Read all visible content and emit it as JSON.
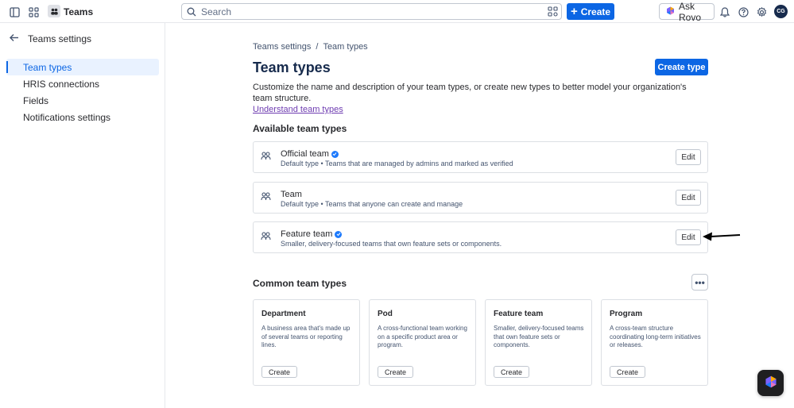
{
  "topbar": {
    "app_name": "Teams",
    "search_placeholder": "Search",
    "create_label": "Create",
    "ask_rovo_label": "Ask Rovo",
    "avatar_initials": "CG",
    "accent": "#0c66e4"
  },
  "sidebar": {
    "title": "Teams settings",
    "items": [
      {
        "label": "Team types",
        "active": true
      },
      {
        "label": "HRIS connections",
        "active": false
      },
      {
        "label": "Fields",
        "active": false
      },
      {
        "label": "Notifications settings",
        "active": false
      }
    ]
  },
  "main": {
    "breadcrumb": [
      "Teams settings",
      "/",
      "Team types"
    ],
    "title": "Team types",
    "create_type_label": "Create type",
    "description": "Customize the name and description of your team types, or create new types to better model your organization's team structure.",
    "description_link": "Understand team types",
    "available_title": "Available team types",
    "available_types": [
      {
        "name": "Official team",
        "verified": true,
        "subtitle": "Default type • Teams that are managed by admins and marked as verified",
        "edit_label": "Edit"
      },
      {
        "name": "Team",
        "verified": false,
        "subtitle": "Default type • Teams that anyone can create and manage",
        "edit_label": "Edit"
      },
      {
        "name": "Feature team",
        "verified": true,
        "subtitle": "Smaller, delivery-focused teams that own feature sets or components.",
        "edit_label": "Edit"
      }
    ],
    "common_title": "Common team types",
    "more_label": "•••",
    "common_types": [
      {
        "name": "Department",
        "desc": "A business area that's made up of several teams or reporting lines.",
        "button": "Create"
      },
      {
        "name": "Pod",
        "desc": "A cross-functional team working on a specific product area or program.",
        "button": "Create"
      },
      {
        "name": "Feature team",
        "desc": "Smaller, delivery-focused teams that own feature sets or components.",
        "button": "Create"
      },
      {
        "name": "Program",
        "desc": "A cross-team structure coordinating long-term initiatives or releases.",
        "button": "Create"
      }
    ]
  }
}
